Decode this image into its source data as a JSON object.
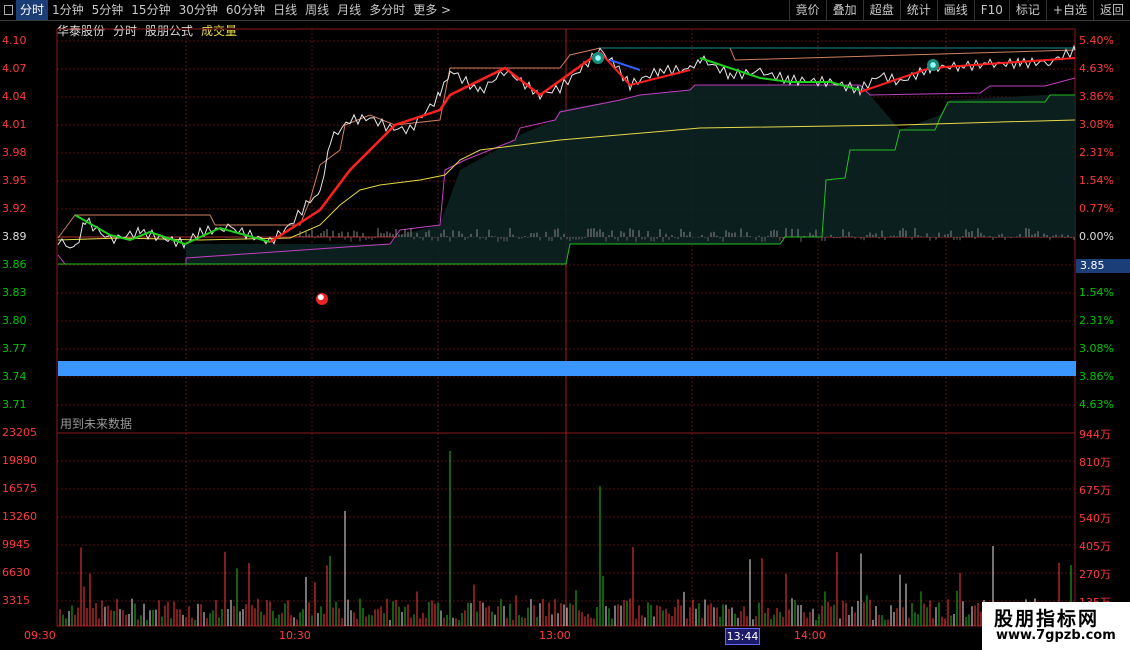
{
  "toolbar": {
    "tabs": [
      "分时",
      "1分钟",
      "5分钟",
      "15分钟",
      "30分钟",
      "60分钟",
      "日线",
      "周线",
      "月线",
      "多分时",
      "更多 >"
    ],
    "right": [
      "竟价",
      "叠加",
      "超盘",
      "统计",
      "画线",
      "F10",
      "标记",
      "+自选",
      "返回"
    ]
  },
  "header": {
    "stock": "华泰股份",
    "view": "分时",
    "formula": "股朋公式",
    "indicator": "成交量"
  },
  "price_axis": [
    "4.10",
    "4.07",
    "4.04",
    "4.01",
    "3.98",
    "3.95",
    "3.92",
    "3.89",
    "3.86",
    "3.83",
    "3.80",
    "3.77",
    "3.74",
    "3.71"
  ],
  "pct_axis": [
    "5.40%",
    "4.63%",
    "3.86%",
    "3.08%",
    "2.31%",
    "1.54%",
    "0.77%",
    "0.00%",
    "",
    "1.54%",
    "2.31%",
    "3.08%",
    "3.86%",
    "4.63%"
  ],
  "price_tag": "3.85",
  "future_note": "用到未来数据",
  "volume_axis_left": [
    "23205",
    "19890",
    "16575",
    "13260",
    "9945",
    "6630",
    "3315"
  ],
  "volume_axis_right": [
    "944万",
    "810万",
    "675万",
    "540万",
    "405万",
    "270万",
    "135万"
  ],
  "time_axis": [
    "09:30",
    "10:30",
    "13:00",
    "14:00"
  ],
  "cursor_time": "13:44",
  "watermark": {
    "title": "股朋指标网",
    "url": "www.7gpzb.com"
  },
  "colors": {
    "up": "#ff3b3b",
    "down": "#00c800",
    "banner": "#3b97ff",
    "avg_line": "#e6d84a"
  }
}
